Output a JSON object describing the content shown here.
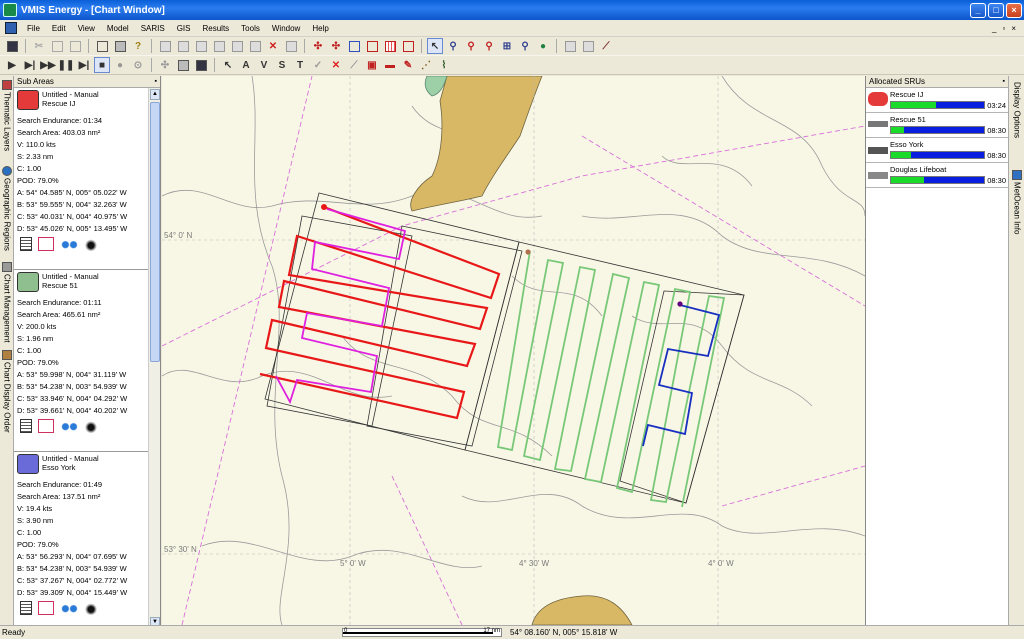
{
  "window": {
    "title": "VMIS Energy - [Chart Window]"
  },
  "menu": [
    "File",
    "Edit",
    "View",
    "Model",
    "SARIS",
    "GIS",
    "Results",
    "Tools",
    "Window",
    "Help"
  ],
  "left_tabs": [
    "Thematic Layers",
    "Geographic Regions",
    "Chart Management",
    "Chart Display Order"
  ],
  "right_tabs": [
    "Display Options",
    "MetOcean Info"
  ],
  "sub_areas": {
    "title": "Sub Areas",
    "entries": [
      {
        "name": "Untitled - Manual",
        "unit": "Rescue IJ",
        "endurance": "Search Endurance: 01:34",
        "area": "Search Area: 403.03 nm²",
        "v": "V: 110.0 kts",
        "s": "S: 2.33 nm",
        "c": "C: 1.00",
        "pod": "POD: 79.0%",
        "a": "A: 54° 04.585' N, 005° 05.022' W",
        "b": "B: 53° 59.555' N, 004° 32.263' W",
        "cc": "C: 53° 40.031' N, 004° 40.975' W",
        "d": "D: 53° 45.026' N, 005° 13.495' W",
        "icon_color": "#e43a3a"
      },
      {
        "name": "Untitled - Manual",
        "unit": "Rescue 51",
        "endurance": "Search Endurance: 01:11",
        "area": "Search Area: 465.61 nm²",
        "v": "V: 200.0 kts",
        "s": "S: 1.96 nm",
        "c": "C: 1.00",
        "pod": "POD: 79.0%",
        "a": "A: 53° 59.998' N, 004° 31.119' W",
        "b": "B: 53° 54.238' N, 003° 54.939' W",
        "cc": "C: 53° 33.946' N, 004° 04.292' W",
        "d": "D: 53° 39.661' N, 004° 40.202' W",
        "icon_color": "#8fbf8f"
      },
      {
        "name": "Untitled - Manual",
        "unit": "Esso York",
        "endurance": "Search Endurance: 01:49",
        "area": "Search Area: 137.51 nm²",
        "v": "V: 19.4 kts",
        "s": "S: 3.90 nm",
        "c": "C: 1.00",
        "pod": "POD: 79.0%",
        "a": "A: 53° 56.293' N, 004° 07.695' W",
        "b": "B: 53° 54.238' N, 003° 54.939' W",
        "cc": "C: 53° 37.267' N, 004° 02.772' W",
        "d": "D: 53° 39.309' N, 004° 15.449' W",
        "icon_color": "#6a6ad8"
      }
    ]
  },
  "allocated": {
    "title": "Allocated SRUs",
    "items": [
      {
        "name": "Rescue IJ",
        "time": "03:24",
        "progress": 0.48
      },
      {
        "name": "Rescue 51",
        "time": "08:30",
        "progress": 0.14
      },
      {
        "name": "Esso York",
        "time": "08:30",
        "progress": 0.22
      },
      {
        "name": "Douglas Lifeboat",
        "time": "08:30",
        "progress": 0.36
      }
    ]
  },
  "map": {
    "lat_labels": [
      "54° 0' N",
      "53° 30' N"
    ],
    "lon_labels": [
      "5° 0' W",
      "4° 30' W",
      "4° 0' W"
    ]
  },
  "status": {
    "ready": "Ready",
    "scale_left": "0",
    "scale_right": "17 nm",
    "coords": "54° 08.160' N, 005° 15.818' W"
  },
  "colors": {
    "track_red": "#e81818",
    "track_magenta": "#e020e0",
    "track_green": "#78c878",
    "track_blue": "#1830c0",
    "land": "#d9b865"
  }
}
